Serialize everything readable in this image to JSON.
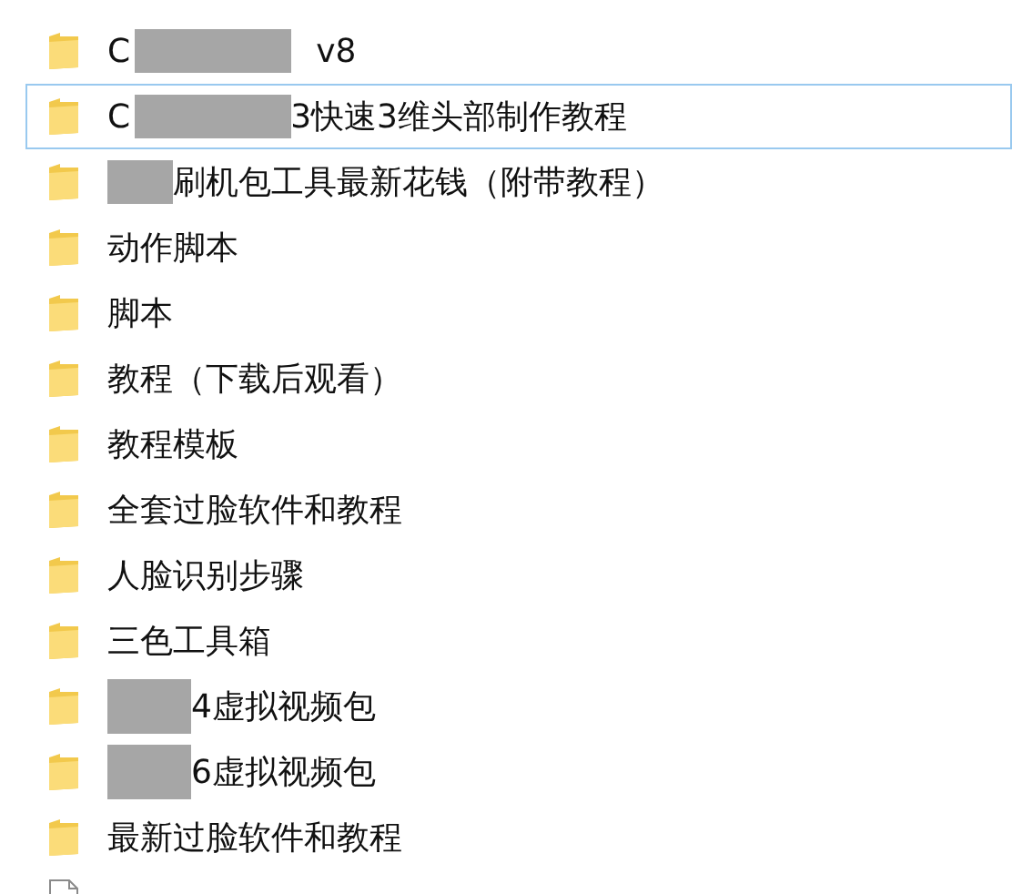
{
  "items": [
    {
      "kind": "folder",
      "selected": false,
      "parts": [
        {
          "kind": "text",
          "text": "C"
        },
        {
          "kind": "redacted"
        },
        {
          "kind": "text",
          "text": "v8"
        }
      ]
    },
    {
      "kind": "folder",
      "selected": true,
      "parts": [
        {
          "kind": "text",
          "text": "C"
        },
        {
          "kind": "redacted"
        },
        {
          "kind": "text",
          "text": "3快速3维头部制作教程"
        }
      ]
    },
    {
      "kind": "folder",
      "selected": false,
      "parts": [
        {
          "kind": "redacted"
        },
        {
          "kind": "text",
          "text": "刷机包工具最新花钱（附带教程）"
        }
      ]
    },
    {
      "kind": "folder",
      "selected": false,
      "parts": [
        {
          "kind": "text",
          "text": "动作脚本"
        }
      ]
    },
    {
      "kind": "folder",
      "selected": false,
      "parts": [
        {
          "kind": "text",
          "text": "脚本"
        }
      ]
    },
    {
      "kind": "folder",
      "selected": false,
      "parts": [
        {
          "kind": "text",
          "text": "教程（下载后观看）"
        }
      ]
    },
    {
      "kind": "folder",
      "selected": false,
      "parts": [
        {
          "kind": "text",
          "text": "教程模板"
        }
      ]
    },
    {
      "kind": "folder",
      "selected": false,
      "parts": [
        {
          "kind": "text",
          "text": "全套过脸软件和教程"
        }
      ]
    },
    {
      "kind": "folder",
      "selected": false,
      "parts": [
        {
          "kind": "text",
          "text": "人脸识别步骤"
        }
      ]
    },
    {
      "kind": "folder",
      "selected": false,
      "parts": [
        {
          "kind": "text",
          "text": "三色工具箱"
        }
      ]
    },
    {
      "kind": "folder",
      "selected": false,
      "parts": [
        {
          "kind": "redacted"
        },
        {
          "kind": "text",
          "text": "4虚拟视频包"
        }
      ]
    },
    {
      "kind": "folder",
      "selected": false,
      "parts": [
        {
          "kind": "redacted"
        },
        {
          "kind": "text",
          "text": "6虚拟视频包"
        }
      ]
    },
    {
      "kind": "folder",
      "selected": false,
      "parts": [
        {
          "kind": "text",
          "text": "最新过脸软件和教程"
        }
      ]
    },
    {
      "kind": "file",
      "selected": false
    }
  ]
}
